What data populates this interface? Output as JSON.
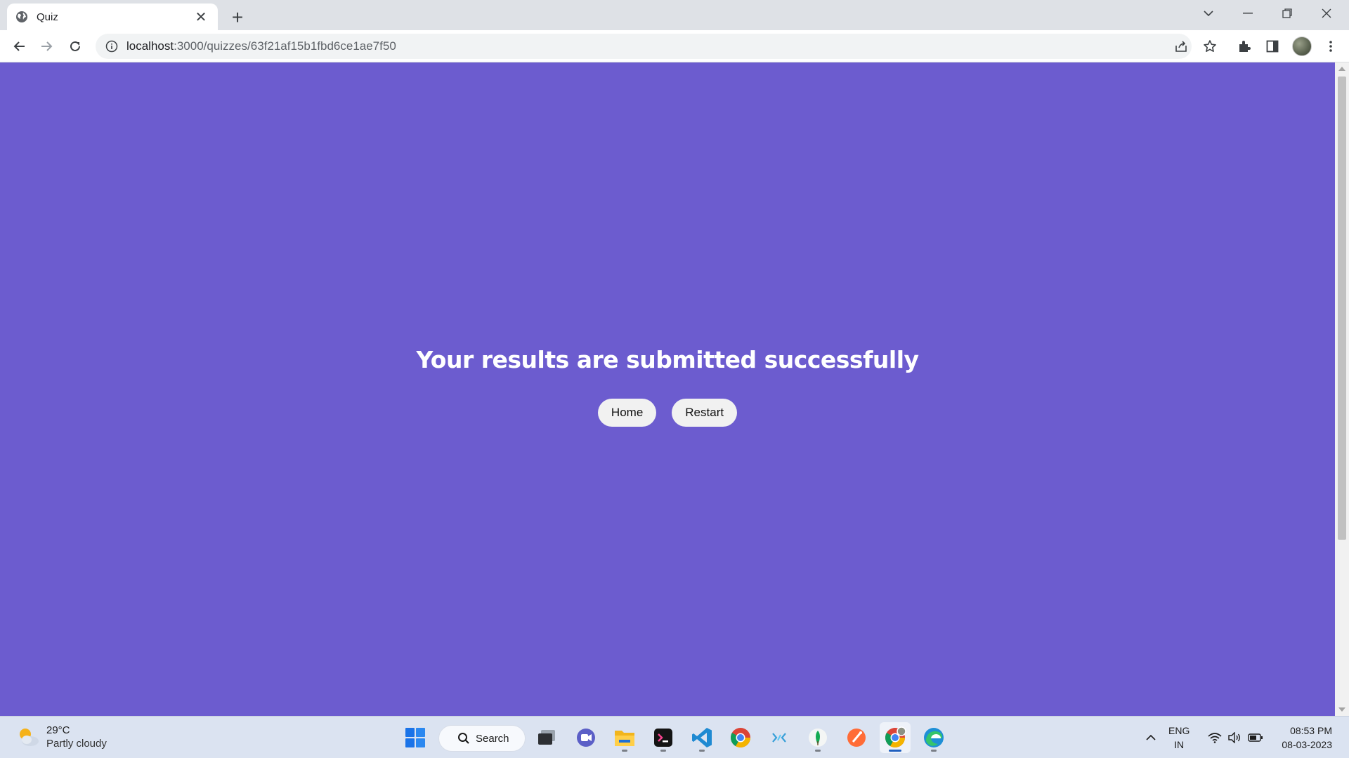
{
  "browser": {
    "tab_title": "Quiz",
    "url_host": "localhost",
    "url_path": ":3000/quizzes/63f21af15b1fbd6ce1ae7f50"
  },
  "page": {
    "headline": "Your results are submitted successfully",
    "home_button": "Home",
    "restart_button": "Restart",
    "background_color": "#6c5ccf"
  },
  "taskbar": {
    "weather_temp": "29°C",
    "weather_condition": "Partly cloudy",
    "search_label": "Search",
    "lang_primary": "ENG",
    "lang_region": "IN",
    "time": "08:53 PM",
    "date": "08-03-2023",
    "apps": [
      "start-icon",
      "task-view-icon",
      "teams-icon",
      "file-explorer-icon",
      "terminal-icon",
      "vscode-icon",
      "chrome-icon",
      "app-icon",
      "mongodb-compass-icon",
      "postman-icon",
      "chrome-active-icon",
      "edge-icon"
    ]
  }
}
